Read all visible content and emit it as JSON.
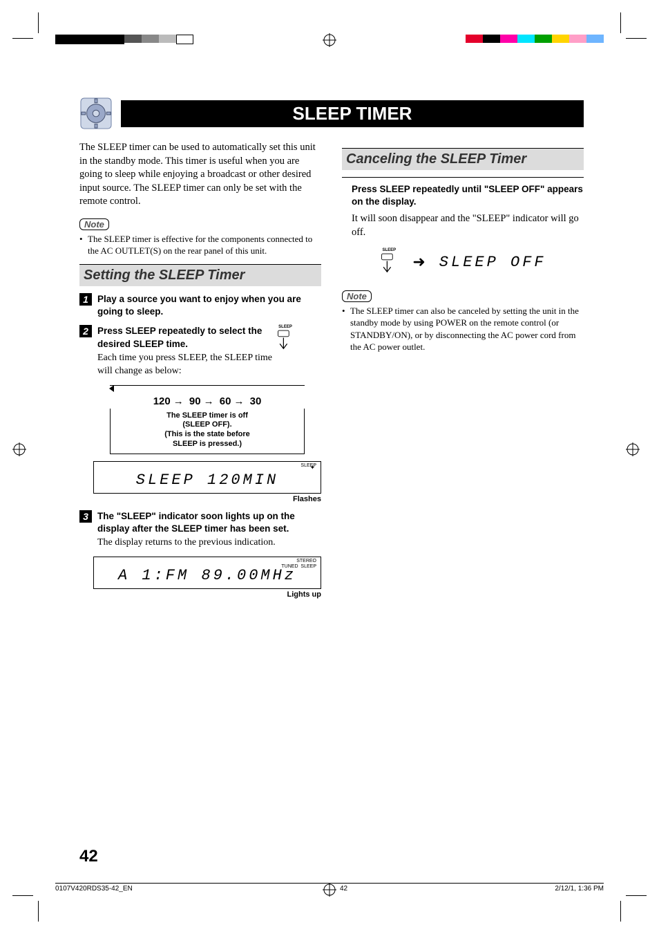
{
  "title": "SLEEP TIMER",
  "intro": "The SLEEP timer can be used to automatically set this unit in the standby mode. This timer is useful when you are going to sleep while enjoying a broadcast or other desired input source. The SLEEP timer can only be set with the remote control.",
  "note_label": "Note",
  "note1": "The SLEEP timer is effective for the components connected to the AC OUTLET(S) on the rear panel of this unit.",
  "setting": {
    "heading": "Setting the SLEEP Timer",
    "step1": "Play a source you want to enjoy when you are going to sleep.",
    "step2_lead": "Press SLEEP repeatedly to select the desired SLEEP time.",
    "step2_follow": "Each time you press SLEEP, the SLEEP time will change as below:",
    "cycle": {
      "a": "120",
      "b": "90",
      "c": "60",
      "d": "30"
    },
    "cycle_note_l1": "The SLEEP timer is off",
    "cycle_note_l2": "(SLEEP OFF).",
    "cycle_note_l3": "(This is the state before",
    "cycle_note_l4": "SLEEP is pressed.)",
    "lcd1_badge": "SLEEP",
    "lcd1_text": "SLEEP   120MIN",
    "lcd1_caption": "Flashes",
    "step3_lead": "The \"SLEEP\" indicator soon lights up on the display after the SLEEP timer has been set.",
    "step3_follow": "The display returns to the previous indication.",
    "lcd2_badges": {
      "stereo": "STEREO",
      "tuned": "TUNED",
      "sleep": "SLEEP"
    },
    "lcd2_text": "A 1:FM  89.00MHz",
    "lcd2_caption": "Lights up",
    "sleep_button_label": "SLEEP"
  },
  "cancel": {
    "heading": "Canceling the SLEEP Timer",
    "instr": "Press SLEEP repeatedly until \"SLEEP OFF\" appears on the display.",
    "follow": "It will soon disappear and the \"SLEEP\" indicator will go off.",
    "remote_label": "SLEEP",
    "seg_text": "SLEEP OFF",
    "note": "The SLEEP timer can also be canceled by setting the unit in the standby mode by using POWER on the remote control (or STANDBY/ON), or by disconnecting the AC power cord from the AC power outlet."
  },
  "page_number": "42",
  "footer": {
    "left": "0107V420RDS35-42_EN",
    "center": "42",
    "right": "2/12/1, 1:36 PM"
  }
}
